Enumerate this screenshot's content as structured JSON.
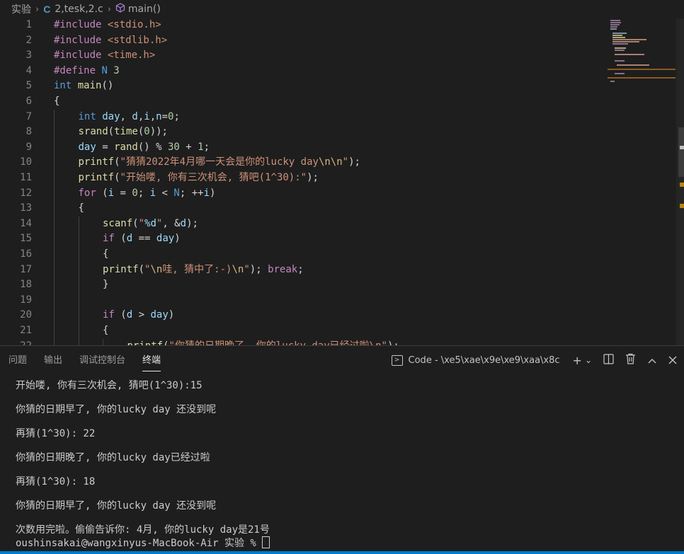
{
  "breadcrumb": {
    "folder": "实验",
    "file_icon": "C",
    "file": "2,tesk,2.c",
    "symbol_icon": "cube-icon",
    "symbol": "main()"
  },
  "editor": {
    "lines": [
      {
        "n": "1",
        "indent": 0,
        "tokens": [
          [
            "kw-pre",
            "#include "
          ],
          [
            "str",
            "<stdio.h>"
          ]
        ]
      },
      {
        "n": "2",
        "indent": 0,
        "tokens": [
          [
            "kw-pre",
            "#include "
          ],
          [
            "str",
            "<stdlib.h>"
          ]
        ]
      },
      {
        "n": "3",
        "indent": 0,
        "tokens": [
          [
            "kw-pre",
            "#include "
          ],
          [
            "str",
            "<time.h>"
          ]
        ]
      },
      {
        "n": "4",
        "indent": 0,
        "tokens": [
          [
            "kw-pre",
            "#define "
          ],
          [
            "macro",
            "N "
          ],
          [
            "num",
            "3"
          ]
        ]
      },
      {
        "n": "5",
        "indent": 0,
        "tokens": [
          [
            "kw-type",
            "int "
          ],
          [
            "fn",
            "main"
          ],
          [
            "op",
            "()"
          ]
        ]
      },
      {
        "n": "6",
        "indent": 0,
        "tokens": [
          [
            "op",
            "{"
          ]
        ]
      },
      {
        "n": "7",
        "indent": 1,
        "tokens": [
          [
            "kw-type",
            "int "
          ],
          [
            "var",
            "day"
          ],
          [
            "op",
            ", "
          ],
          [
            "var",
            "d"
          ],
          [
            "op",
            ","
          ],
          [
            "var",
            "i"
          ],
          [
            "op",
            ","
          ],
          [
            "var",
            "n"
          ],
          [
            "op",
            "="
          ],
          [
            "num",
            "0"
          ],
          [
            "op",
            ";"
          ]
        ]
      },
      {
        "n": "8",
        "indent": 1,
        "tokens": [
          [
            "fn",
            "srand"
          ],
          [
            "op",
            "("
          ],
          [
            "fn",
            "time"
          ],
          [
            "op",
            "("
          ],
          [
            "num",
            "0"
          ],
          [
            "op",
            "));"
          ]
        ]
      },
      {
        "n": "9",
        "indent": 1,
        "tokens": [
          [
            "var",
            "day"
          ],
          [
            "op",
            " = "
          ],
          [
            "fn",
            "rand"
          ],
          [
            "op",
            "() % "
          ],
          [
            "num",
            "30"
          ],
          [
            "op",
            " + "
          ],
          [
            "num",
            "1"
          ],
          [
            "op",
            ";"
          ]
        ]
      },
      {
        "n": "10",
        "indent": 1,
        "tokens": [
          [
            "fn",
            "printf"
          ],
          [
            "op",
            "("
          ],
          [
            "str",
            "\"猜猜2022年4月哪一天会是你的lucky day"
          ],
          [
            "esc",
            "\\n\\n"
          ],
          [
            "str",
            "\""
          ],
          [
            "op",
            ");"
          ]
        ]
      },
      {
        "n": "11",
        "indent": 1,
        "tokens": [
          [
            "fn",
            "printf"
          ],
          [
            "op",
            "("
          ],
          [
            "str",
            "\"开始喽, 你有三次机会, 猜吧(1^30):\""
          ],
          [
            "op",
            ");"
          ]
        ]
      },
      {
        "n": "12",
        "indent": 1,
        "tokens": [
          [
            "kw-ctrl",
            "for "
          ],
          [
            "op",
            "("
          ],
          [
            "var",
            "i"
          ],
          [
            "op",
            " = "
          ],
          [
            "num",
            "0"
          ],
          [
            "op",
            "; "
          ],
          [
            "var",
            "i"
          ],
          [
            "op",
            " < "
          ],
          [
            "macro",
            "N"
          ],
          [
            "op",
            "; ++"
          ],
          [
            "var",
            "i"
          ],
          [
            "op",
            ")"
          ]
        ]
      },
      {
        "n": "13",
        "indent": 1,
        "tokens": [
          [
            "op",
            "{"
          ]
        ]
      },
      {
        "n": "14",
        "indent": 2,
        "tokens": [
          [
            "fn",
            "scanf"
          ],
          [
            "op",
            "("
          ],
          [
            "str",
            "\""
          ],
          [
            "var",
            "%d"
          ],
          [
            "str",
            "\""
          ],
          [
            "op",
            ", &"
          ],
          [
            "var",
            "d"
          ],
          [
            "op",
            ");"
          ]
        ]
      },
      {
        "n": "15",
        "indent": 2,
        "tokens": [
          [
            "kw-ctrl",
            "if "
          ],
          [
            "op",
            "("
          ],
          [
            "var",
            "d"
          ],
          [
            "op",
            " == "
          ],
          [
            "var",
            "day"
          ],
          [
            "op",
            ")"
          ]
        ]
      },
      {
        "n": "16",
        "indent": 2,
        "tokens": [
          [
            "op",
            "{"
          ]
        ]
      },
      {
        "n": "17",
        "indent": 2,
        "tokens": [
          [
            "fn",
            "printf"
          ],
          [
            "op",
            "("
          ],
          [
            "str",
            "\""
          ],
          [
            "esc",
            "\\n"
          ],
          [
            "str",
            "哇, 猜中了:-)"
          ],
          [
            "esc",
            "\\n"
          ],
          [
            "str",
            "\""
          ],
          [
            "op",
            "); "
          ],
          [
            "kw-ctrl",
            "break"
          ],
          [
            "op",
            ";"
          ]
        ]
      },
      {
        "n": "18",
        "indent": 2,
        "tokens": [
          [
            "op",
            "}"
          ]
        ]
      },
      {
        "n": "19",
        "indent": 2,
        "tokens": []
      },
      {
        "n": "20",
        "indent": 2,
        "tokens": [
          [
            "kw-ctrl",
            "if "
          ],
          [
            "op",
            "("
          ],
          [
            "var",
            "d"
          ],
          [
            "op",
            " > "
          ],
          [
            "var",
            "day"
          ],
          [
            "op",
            ")"
          ]
        ]
      },
      {
        "n": "21",
        "indent": 2,
        "tokens": [
          [
            "op",
            "{"
          ]
        ]
      },
      {
        "n": "22",
        "indent": 3,
        "tokens": [
          [
            "fn",
            "printf"
          ],
          [
            "op",
            "("
          ],
          [
            "str",
            "\"你猜的日期晚了, 你的lucky day已经过啦\\n\""
          ],
          [
            "op",
            ");"
          ]
        ]
      }
    ]
  },
  "panel": {
    "tabs": [
      "问题",
      "输出",
      "调试控制台",
      "终端"
    ],
    "active_tab": 3,
    "terminal_name": "Code - \\xe5\\xae\\x9e\\xe9\\xaa\\x8c",
    "icons": [
      "terminal-icon",
      "add-icon",
      "chevron-down-icon",
      "split-icon",
      "trash-icon",
      "maximize-icon",
      "close-icon"
    ]
  },
  "terminal": {
    "lines": [
      "开始喽, 你有三次机会, 猜吧(1^30):15",
      "",
      "你猜的日期早了, 你的lucky day 还没到呢",
      "",
      "再猜(1^30): 22",
      "",
      "你猜的日期晚了, 你的lucky day已经过啦",
      "",
      "再猜(1^30): 18",
      "",
      "你猜的日期早了, 你的lucky day 还没到呢",
      "",
      "次数用完啦。偷偷告诉你: 4月, 你的lucky day是21号"
    ],
    "prompt": "oushinsakai@wangxinyus-MacBook-Air 实验 % "
  },
  "colors": {
    "background": "#1e1e1e",
    "status_bar": "#007acc",
    "keyword_purple": "#c586c0",
    "type_blue": "#569cd6",
    "function_yellow": "#dcdcaa",
    "string_orange": "#ce9178",
    "variable_lightblue": "#9cdcfe",
    "number_green": "#b5cea8"
  }
}
